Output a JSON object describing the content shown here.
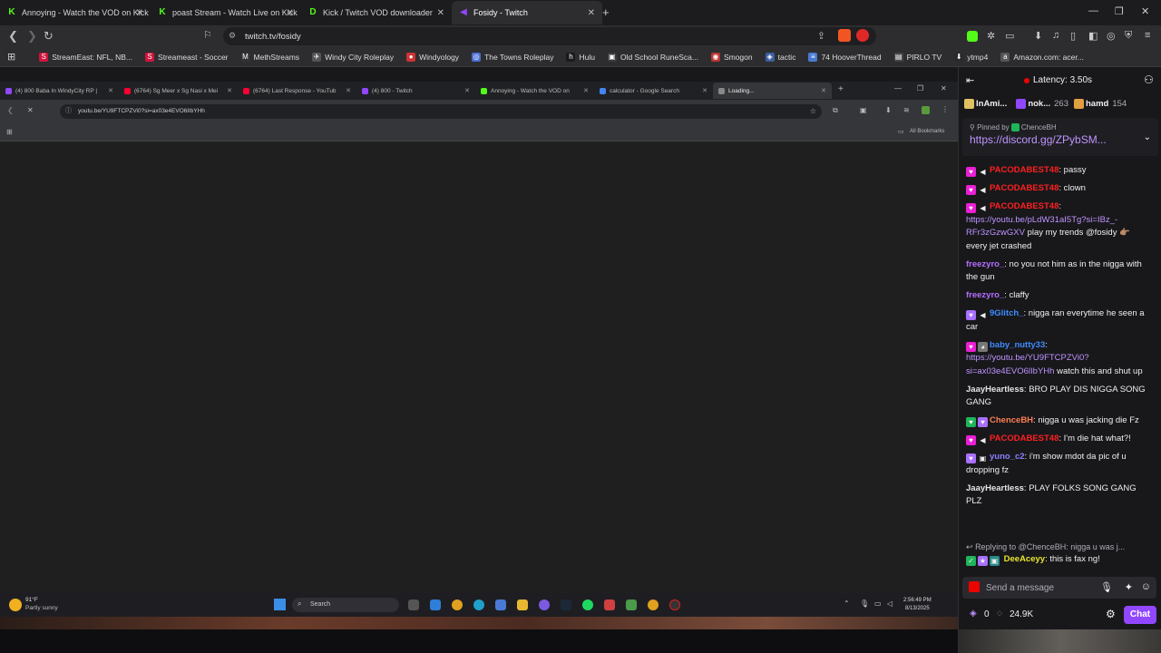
{
  "outer_tabs": [
    {
      "label": "Annoying - Watch the VOD on Kick",
      "fav": "K",
      "color": "#53fc18"
    },
    {
      "label": "poast Stream - Watch Live on Kick",
      "fav": "K",
      "color": "#53fc18"
    },
    {
      "label": "Kick / Twitch VOD downloader",
      "fav": "D",
      "color": "#53fc18"
    },
    {
      "label": "Fosidy - Twitch",
      "fav": "◀",
      "color": "#9147ff"
    }
  ],
  "address": {
    "url": "twitch.tv/fosidy"
  },
  "bookmarks": [
    {
      "label": "StreamEast: NFL, NB...",
      "icon": "S",
      "color": "#d0143c"
    },
    {
      "label": "Streameast - Soccer",
      "icon": "S",
      "color": "#d0143c"
    },
    {
      "label": "MethStreams",
      "icon": "M",
      "color": "#333"
    },
    {
      "label": "Windy City Roleplay",
      "icon": "✈",
      "color": "#555"
    },
    {
      "label": "Windyology",
      "icon": "●",
      "color": "#c33"
    },
    {
      "label": "The Towns Roleplay",
      "icon": "◎",
      "color": "#4a6fd1"
    },
    {
      "label": "Hulu",
      "icon": "h",
      "color": "#1a1a1a"
    },
    {
      "label": "Old School RuneSca...",
      "icon": "▣",
      "color": "#3a3a3a"
    },
    {
      "label": "Smogon",
      "icon": "◉",
      "color": "#b33"
    },
    {
      "label": "tactic",
      "icon": "◈",
      "color": "#3a5fa0"
    },
    {
      "label": "74 HooverThread",
      "icon": "≡",
      "color": "#4a7bd1"
    },
    {
      "label": "PIRLO TV",
      "icon": "▤",
      "color": "#444"
    },
    {
      "label": "ytmp4",
      "icon": "⬇",
      "color": "#2a2a2a"
    },
    {
      "label": "Amazon.com: acer...",
      "icon": "a",
      "color": "#555"
    }
  ],
  "inner_browser": {
    "tabs": [
      {
        "label": "(4) 800 Baba In WindyCity RP |",
        "color": "#9147ff"
      },
      {
        "label": "(6764) Sg Meer x Sg Nasi x Mei",
        "color": "#ff0033"
      },
      {
        "label": "(6764) Last Response - YouTub",
        "color": "#ff0033"
      },
      {
        "label": "(4) 800 - Twitch",
        "color": "#9147ff"
      },
      {
        "label": "Annoying - Watch the VOD on",
        "color": "#53fc18"
      },
      {
        "label": "calculator - Google Search",
        "color": "#4285f4"
      },
      {
        "label": "Loading...",
        "color": "#888"
      }
    ],
    "url": "youtu.be/YU9FTCPZVi0?si=ax03e4EVO6lIbYHh",
    "all_bookmarks": "All Bookmarks",
    "taskbar": {
      "weather_temp": "91°F",
      "weather_desc": "Partly sunny",
      "search_label": "Search",
      "time": "2:56:49 PM",
      "date": "8/13/2025"
    }
  },
  "chat": {
    "latency": "Latency: 3.50s",
    "leaderboard": [
      {
        "name": "InAmi...",
        "count": "",
        "color": "#e0c060"
      },
      {
        "name": "nok...",
        "count": "263",
        "color": "#9147ff"
      },
      {
        "name": "hamd",
        "count": "154",
        "color": "#e0a040"
      }
    ],
    "pinned_by_label": "Pinned by",
    "pinned_by_user": "ChenceBH",
    "pinned_link": "https://discord.gg/ZPybSM...",
    "messages": [
      {
        "user": "PACODABEST48",
        "color": "#ff1f1f",
        "badges": [
          "#e91fd3",
          "mute"
        ],
        "text": "passy"
      },
      {
        "user": "PACODABEST48",
        "color": "#ff1f1f",
        "badges": [
          "#e91fd3",
          "mute"
        ],
        "text": "clown"
      },
      {
        "user": "PACODABEST48",
        "color": "#ff1f1f",
        "badges": [
          "#e91fd3",
          "mute"
        ],
        "link": "https://youtu.be/pLdW31aI5Tg?si=IBz_-RFr3zGzwGXV",
        "text": "play my trends @fosidy 👉🏽 every jet crashed"
      },
      {
        "user": "freezyro_",
        "color": "#b46dff",
        "badges": [],
        "text": "no you not him as in the nigga with the gun"
      },
      {
        "user": "freezyro_",
        "color": "#b46dff",
        "badges": [],
        "text": "claffy"
      },
      {
        "user": "9Glitch_",
        "color": "#3d8bff",
        "badges": [
          "#a970ff",
          "mute"
        ],
        "text": "nigga ran everytime he seen a car"
      },
      {
        "user": "baby_nutty33",
        "color": "#3d8bff",
        "badges": [
          "#e91fd3",
          "wolf"
        ],
        "link": "https://youtu.be/YU9FTCPZVi0?si=ax03e4EVO6lIbYHh",
        "text": "watch this and shut up"
      },
      {
        "user": "JaayHeartless",
        "color": "#e6e6e6",
        "badges": [],
        "text": "BRO PLAY DIS NIGGA SONG GANG"
      },
      {
        "user": "ChenceBH",
        "color": "#ff7f50",
        "badges": [
          "#1fb559",
          "#a970ff"
        ],
        "text": "nigga u was jacking die Fz"
      },
      {
        "user": "PACODABEST48",
        "color": "#ff1f1f",
        "badges": [
          "#e91fd3",
          "mute"
        ],
        "text": "I'm die hat what?!"
      },
      {
        "user": "yuno_c2",
        "color": "#8c7fff",
        "badges": [
          "#a970ff",
          "cam"
        ],
        "text": "i'm show mdot da pic of u dropping fz"
      },
      {
        "user": "JaayHeartless",
        "color": "#e6e6e6",
        "badges": [],
        "text": "PLAY FOLKS SONG GANG PLZ"
      }
    ],
    "reply_context": "Replying to @ChenceBH: nigga u was j...",
    "reply_msg": {
      "user": "DeeAceyy",
      "color": "#e8e42c",
      "text": "this is fax ng!"
    },
    "input_placeholder": "Send a message",
    "points": "0",
    "viewers": "24.9K",
    "chat_button": "Chat"
  }
}
